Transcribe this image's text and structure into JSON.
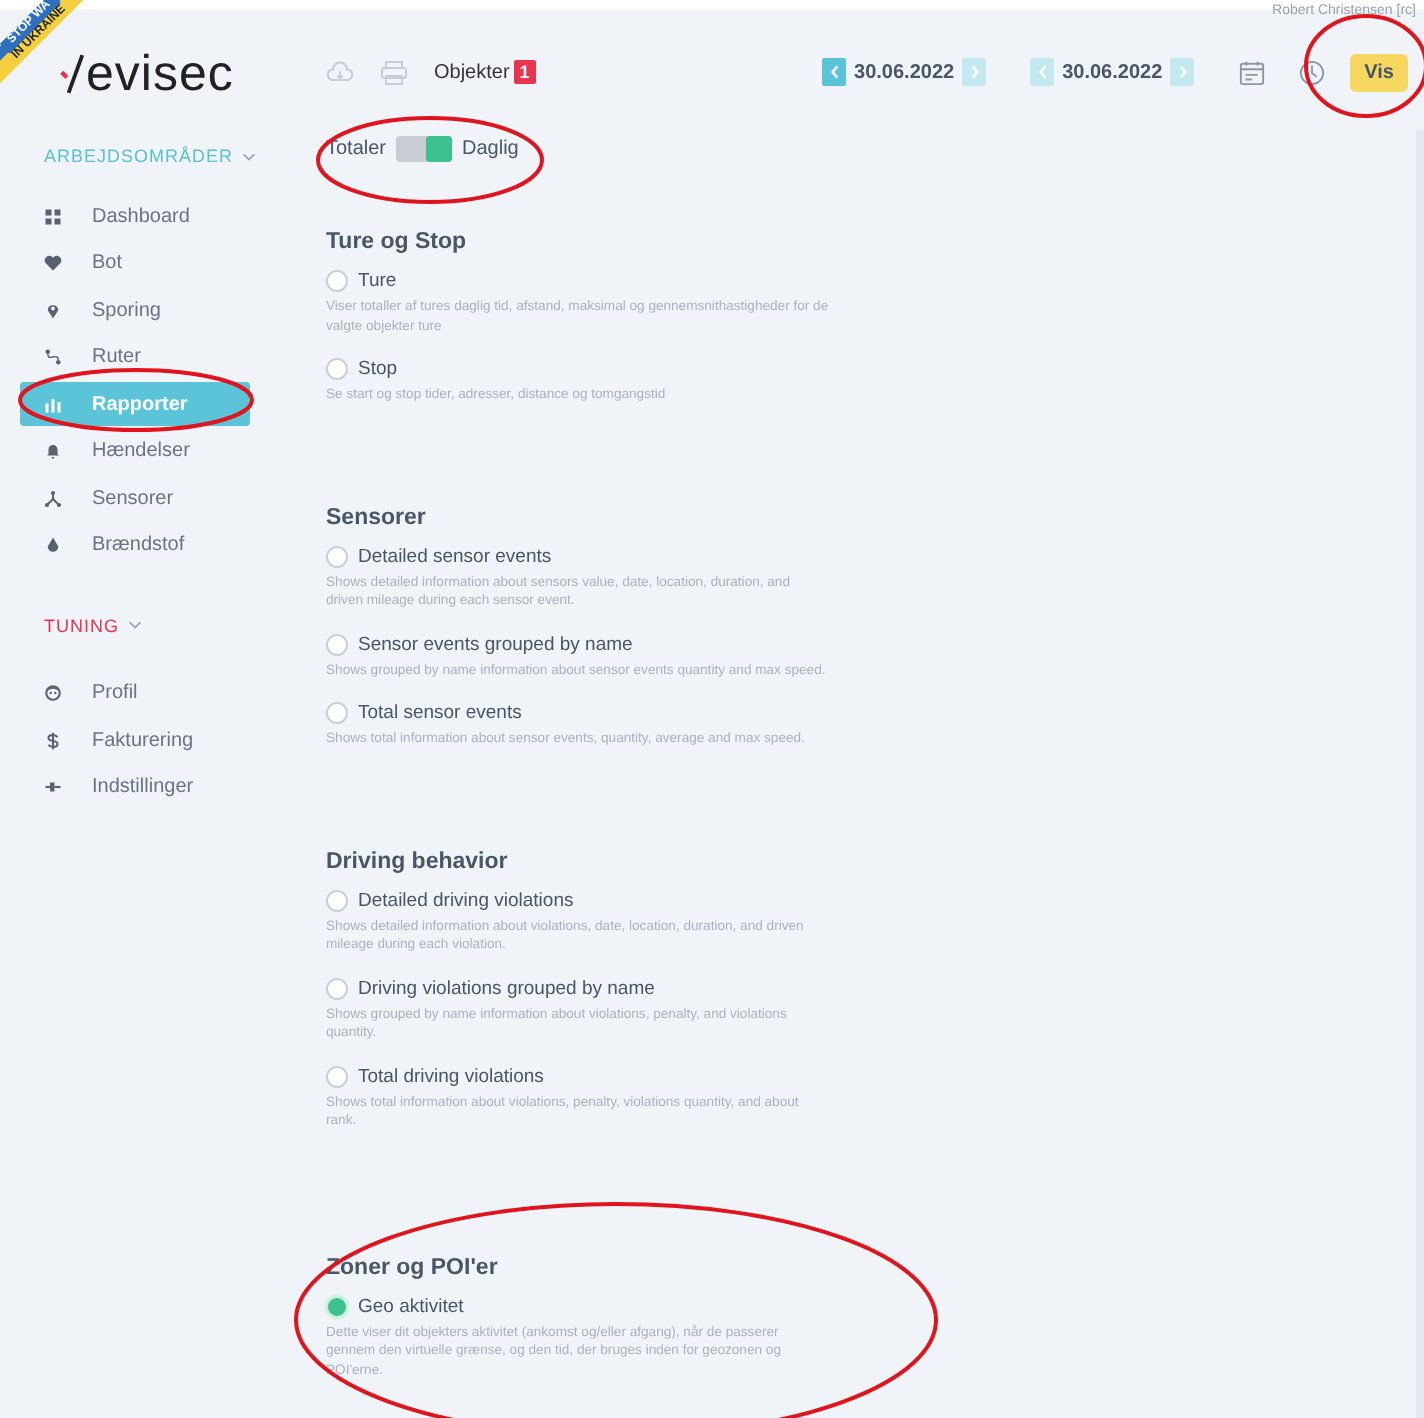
{
  "banner": {
    "line_1": "STOP WA",
    "line_2": "IN UKRAINE"
  },
  "logo": {
    "text": "evisec"
  },
  "header": {
    "user": "Robert Christensen [rc]",
    "objects_label": "Objekter",
    "objects_count": "1",
    "date_from": {
      "value": "30.06.2022",
      "prev_enabled": true,
      "next_enabled": false
    },
    "date_to": {
      "value": "30.06.2022",
      "prev_enabled": false,
      "next_enabled": false
    },
    "show_button": "Vis"
  },
  "sidebar": {
    "groups": [
      {
        "title": "ARBEJDSOMRÅDER",
        "color": "#5bbfd3",
        "items": [
          {
            "label": "Dashboard",
            "kind": "grid",
            "selected": false
          },
          {
            "label": "Bot",
            "kind": "heart",
            "selected": false
          },
          {
            "label": "Sporing",
            "kind": "pin",
            "selected": false
          },
          {
            "label": "Ruter",
            "kind": "route",
            "selected": false
          },
          {
            "label": "Rapporter",
            "kind": "bars",
            "selected": true
          },
          {
            "label": "Hændelser",
            "kind": "bell",
            "selected": false
          },
          {
            "label": "Sensorer",
            "kind": "nodes",
            "selected": false
          },
          {
            "label": "Brændstof",
            "kind": "drop",
            "selected": false
          }
        ]
      },
      {
        "title": "TUNING",
        "color": "#e8344e",
        "items": [
          {
            "label": "Profil",
            "kind": "face",
            "selected": false
          },
          {
            "label": "Fakturering",
            "kind": "dollar",
            "selected": false
          },
          {
            "label": "Indstillinger",
            "kind": "plug",
            "selected": false
          }
        ]
      }
    ]
  },
  "toggle": {
    "left_label": "Totaler",
    "right_label": "Daglig",
    "on": true
  },
  "sections": [
    {
      "title": "Ture og Stop",
      "options": [
        {
          "label": "Ture",
          "description": "Viser totaller af tures daglig tid, afstand, maksimal og gennemsnithastigheder for de valgte objekter ture",
          "selected": false
        },
        {
          "label": "Stop",
          "description": "Se start og stop tider, adresser, distance og tomgangstid",
          "selected": false
        }
      ]
    },
    {
      "title": "Sensorer",
      "options": [
        {
          "label": "Detailed sensor events",
          "description": "Shows detailed information about sensors value, date, location, duration, and driven mileage during each sensor event.",
          "selected": false
        },
        {
          "label": "Sensor events grouped by name",
          "description": "Shows grouped by name information about sensor events quantity and max speed.",
          "selected": false
        },
        {
          "label": "Total sensor events",
          "description": "Shows total information about sensor events, quantity, average and max speed.",
          "selected": false
        }
      ]
    },
    {
      "title": "Driving behavior",
      "options": [
        {
          "label": "Detailed driving violations",
          "description": "Shows detailed information about violations, date, location, duration, and driven mileage during each violation.",
          "selected": false
        },
        {
          "label": "Driving violations grouped by name",
          "description": "Shows grouped by name information about violations, penalty, and violations quantity.",
          "selected": false
        },
        {
          "label": "Total driving violations",
          "description": "Shows total information about violations, penalty, violations quantity, and about rank.",
          "selected": false
        }
      ]
    },
    {
      "title": "Zoner og POI'er",
      "options": [
        {
          "label": "Geo aktivitet",
          "description": "Dette viser dit objekters aktivitet (ankomst og/eller afgang), når de passerer gennem den virtuelle grænse, og den tid, der bruges inden for geozonen og POI'erne.",
          "selected": true
        }
      ]
    }
  ]
}
